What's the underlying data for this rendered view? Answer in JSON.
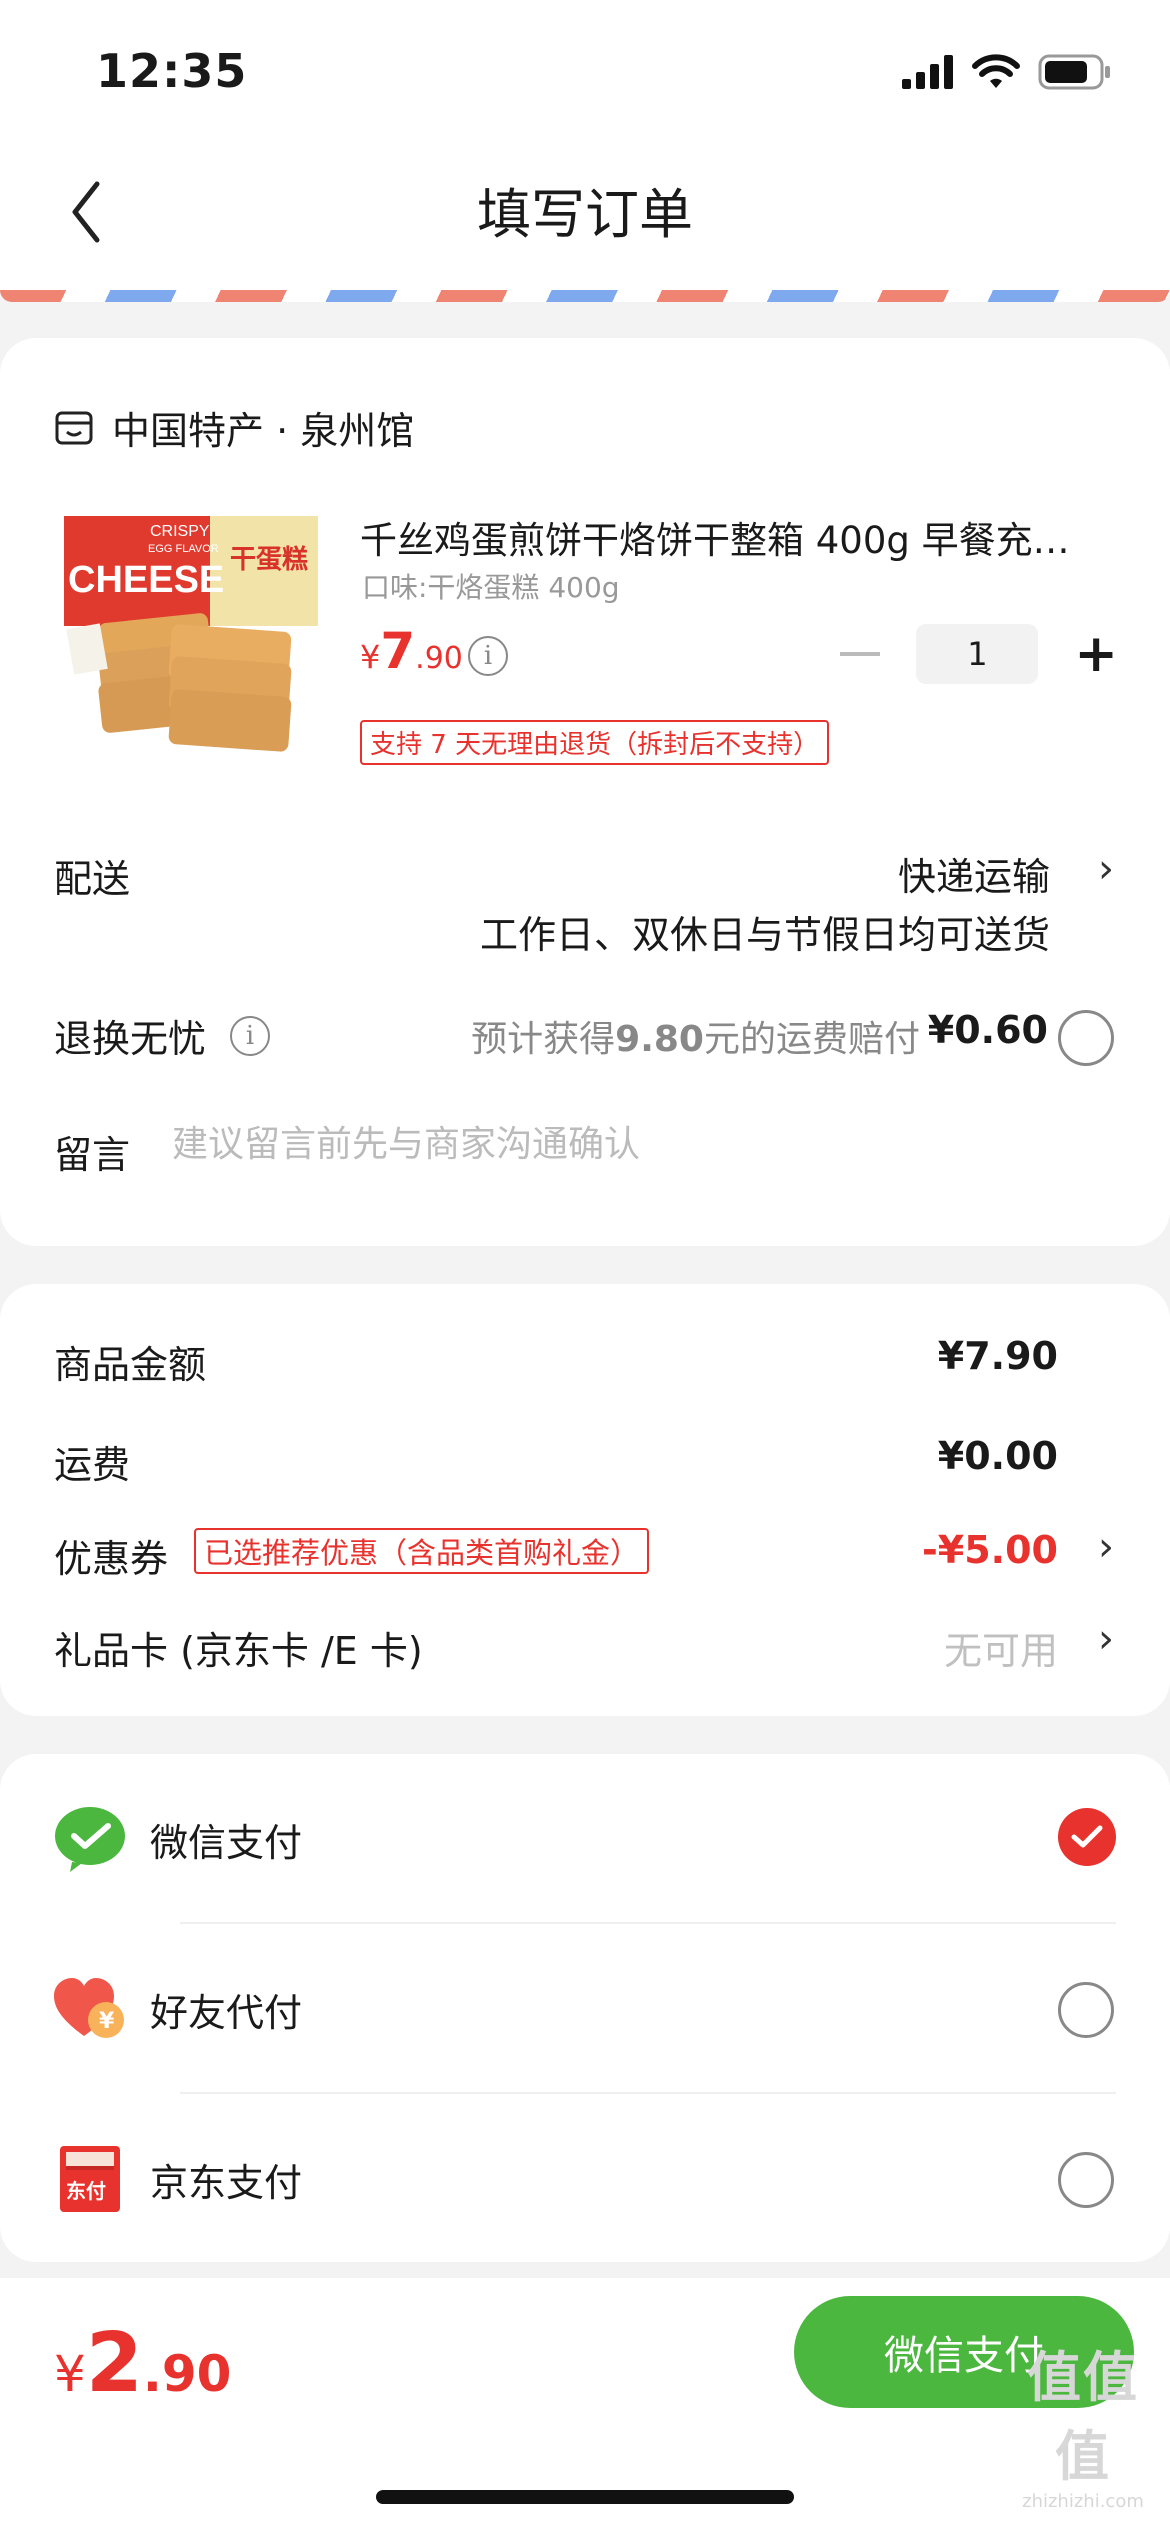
{
  "status_bar": {
    "time": "12:35"
  },
  "nav": {
    "title": "填写订单"
  },
  "order": {
    "shop_name": "中国特产 · 泉州馆",
    "product": {
      "title": "千丝鸡蛋煎饼干烙饼干整箱 400g 早餐充…",
      "spec": "口味:干烙蛋糕 400g",
      "price_currency": "¥",
      "price_int": "7",
      "price_dec": ".90",
      "quantity": "1",
      "return_badge": "支持 7 天无理由退货（拆封后不支持）",
      "image_texts": {
        "crispy": "CRISPY",
        "egg_flavor": "EGG FLAVOR",
        "cheese": "CHEESE",
        "badge": "干蛋糕"
      }
    },
    "delivery": {
      "label": "配送",
      "value": "快递运输",
      "sub": "工作日、双休日与节假日均可送货"
    },
    "exchange": {
      "label": "退换无忧",
      "text_prefix": "预计获得",
      "amount": "9.80",
      "text_suffix": "元的运费赔付",
      "price": "¥0.60"
    },
    "message": {
      "label": "留言",
      "placeholder": "建议留言前先与商家沟通确认"
    }
  },
  "summary": {
    "goods_label": "商品金额",
    "goods_value": "¥7.90",
    "shipping_label": "运费",
    "shipping_value": "¥0.00",
    "coupon_label": "优惠券",
    "coupon_badge": "已选推荐优惠（含品类首购礼金）",
    "coupon_value": "-¥5.00",
    "giftcard_label": "礼品卡 (京东卡 /E 卡)",
    "giftcard_value": "无可用"
  },
  "payment": {
    "methods": [
      {
        "label": "微信支付",
        "selected": true
      },
      {
        "label": "好友代付",
        "selected": false
      },
      {
        "label": "京东支付",
        "selected": false
      }
    ],
    "friend_icon_text": "¥",
    "jd_icon_text": "东付"
  },
  "bottom": {
    "total_currency": "¥",
    "total_int": "2",
    "total_dec": ".90",
    "pay_button": "微信支付"
  },
  "watermark": {
    "logo": "值值值",
    "url": "zhizhizhi.com"
  },
  "colors": {
    "accent_red": "#e8322d",
    "wechat_green": "#4bb73e"
  }
}
